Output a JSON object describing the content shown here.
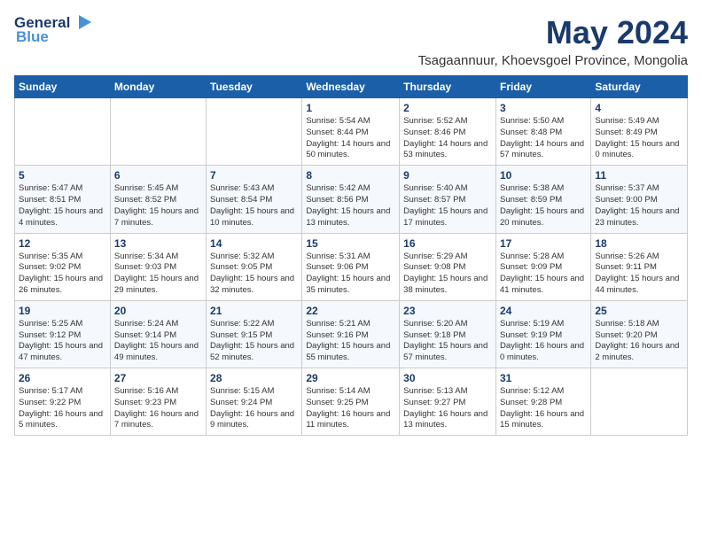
{
  "logo": {
    "general": "General",
    "blue": "Blue"
  },
  "title": "May 2024",
  "subtitle": "Tsagaannuur, Khoevsgoel Province, Mongolia",
  "weekdays": [
    "Sunday",
    "Monday",
    "Tuesday",
    "Wednesday",
    "Thursday",
    "Friday",
    "Saturday"
  ],
  "weeks": [
    [
      {
        "day": "",
        "info": ""
      },
      {
        "day": "",
        "info": ""
      },
      {
        "day": "",
        "info": ""
      },
      {
        "day": "1",
        "info": "Sunrise: 5:54 AM\nSunset: 8:44 PM\nDaylight: 14 hours\nand 50 minutes."
      },
      {
        "day": "2",
        "info": "Sunrise: 5:52 AM\nSunset: 8:46 PM\nDaylight: 14 hours\nand 53 minutes."
      },
      {
        "day": "3",
        "info": "Sunrise: 5:50 AM\nSunset: 8:48 PM\nDaylight: 14 hours\nand 57 minutes."
      },
      {
        "day": "4",
        "info": "Sunrise: 5:49 AM\nSunset: 8:49 PM\nDaylight: 15 hours\nand 0 minutes."
      }
    ],
    [
      {
        "day": "5",
        "info": "Sunrise: 5:47 AM\nSunset: 8:51 PM\nDaylight: 15 hours\nand 4 minutes."
      },
      {
        "day": "6",
        "info": "Sunrise: 5:45 AM\nSunset: 8:52 PM\nDaylight: 15 hours\nand 7 minutes."
      },
      {
        "day": "7",
        "info": "Sunrise: 5:43 AM\nSunset: 8:54 PM\nDaylight: 15 hours\nand 10 minutes."
      },
      {
        "day": "8",
        "info": "Sunrise: 5:42 AM\nSunset: 8:56 PM\nDaylight: 15 hours\nand 13 minutes."
      },
      {
        "day": "9",
        "info": "Sunrise: 5:40 AM\nSunset: 8:57 PM\nDaylight: 15 hours\nand 17 minutes."
      },
      {
        "day": "10",
        "info": "Sunrise: 5:38 AM\nSunset: 8:59 PM\nDaylight: 15 hours\nand 20 minutes."
      },
      {
        "day": "11",
        "info": "Sunrise: 5:37 AM\nSunset: 9:00 PM\nDaylight: 15 hours\nand 23 minutes."
      }
    ],
    [
      {
        "day": "12",
        "info": "Sunrise: 5:35 AM\nSunset: 9:02 PM\nDaylight: 15 hours\nand 26 minutes."
      },
      {
        "day": "13",
        "info": "Sunrise: 5:34 AM\nSunset: 9:03 PM\nDaylight: 15 hours\nand 29 minutes."
      },
      {
        "day": "14",
        "info": "Sunrise: 5:32 AM\nSunset: 9:05 PM\nDaylight: 15 hours\nand 32 minutes."
      },
      {
        "day": "15",
        "info": "Sunrise: 5:31 AM\nSunset: 9:06 PM\nDaylight: 15 hours\nand 35 minutes."
      },
      {
        "day": "16",
        "info": "Sunrise: 5:29 AM\nSunset: 9:08 PM\nDaylight: 15 hours\nand 38 minutes."
      },
      {
        "day": "17",
        "info": "Sunrise: 5:28 AM\nSunset: 9:09 PM\nDaylight: 15 hours\nand 41 minutes."
      },
      {
        "day": "18",
        "info": "Sunrise: 5:26 AM\nSunset: 9:11 PM\nDaylight: 15 hours\nand 44 minutes."
      }
    ],
    [
      {
        "day": "19",
        "info": "Sunrise: 5:25 AM\nSunset: 9:12 PM\nDaylight: 15 hours\nand 47 minutes."
      },
      {
        "day": "20",
        "info": "Sunrise: 5:24 AM\nSunset: 9:14 PM\nDaylight: 15 hours\nand 49 minutes."
      },
      {
        "day": "21",
        "info": "Sunrise: 5:22 AM\nSunset: 9:15 PM\nDaylight: 15 hours\nand 52 minutes."
      },
      {
        "day": "22",
        "info": "Sunrise: 5:21 AM\nSunset: 9:16 PM\nDaylight: 15 hours\nand 55 minutes."
      },
      {
        "day": "23",
        "info": "Sunrise: 5:20 AM\nSunset: 9:18 PM\nDaylight: 15 hours\nand 57 minutes."
      },
      {
        "day": "24",
        "info": "Sunrise: 5:19 AM\nSunset: 9:19 PM\nDaylight: 16 hours\nand 0 minutes."
      },
      {
        "day": "25",
        "info": "Sunrise: 5:18 AM\nSunset: 9:20 PM\nDaylight: 16 hours\nand 2 minutes."
      }
    ],
    [
      {
        "day": "26",
        "info": "Sunrise: 5:17 AM\nSunset: 9:22 PM\nDaylight: 16 hours\nand 5 minutes."
      },
      {
        "day": "27",
        "info": "Sunrise: 5:16 AM\nSunset: 9:23 PM\nDaylight: 16 hours\nand 7 minutes."
      },
      {
        "day": "28",
        "info": "Sunrise: 5:15 AM\nSunset: 9:24 PM\nDaylight: 16 hours\nand 9 minutes."
      },
      {
        "day": "29",
        "info": "Sunrise: 5:14 AM\nSunset: 9:25 PM\nDaylight: 16 hours\nand 11 minutes."
      },
      {
        "day": "30",
        "info": "Sunrise: 5:13 AM\nSunset: 9:27 PM\nDaylight: 16 hours\nand 13 minutes."
      },
      {
        "day": "31",
        "info": "Sunrise: 5:12 AM\nSunset: 9:28 PM\nDaylight: 16 hours\nand 15 minutes."
      },
      {
        "day": "",
        "info": ""
      }
    ]
  ]
}
